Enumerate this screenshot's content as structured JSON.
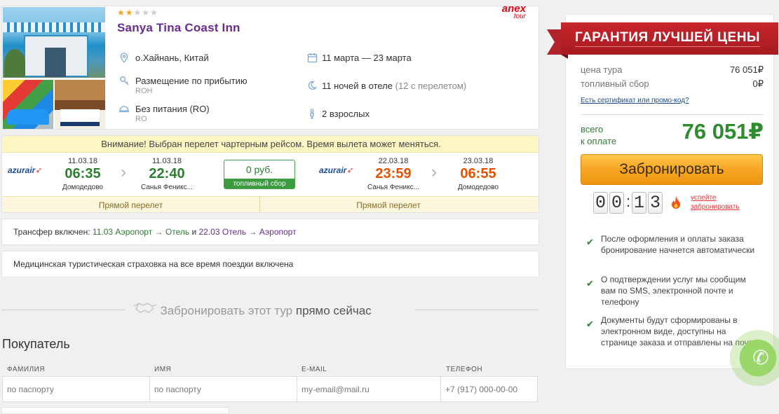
{
  "hotel": {
    "stars_on": "★★",
    "stars_off": "★★★",
    "name": "Sanya Tina Coast Inn",
    "operator_line1": "anex",
    "operator_line2": "tour",
    "location": "о.Хайнань, Китай",
    "room": "Размещение по прибытию",
    "room_code": "ROH",
    "meal": "Без питания (RO)",
    "meal_code": "RO",
    "dates": "11 марта — 23 марта",
    "nights": "11 ночей в отеле",
    "nights_extra": "(12 с перелетом)",
    "guests": "2 взрослых"
  },
  "flight": {
    "warning": "Внимание! Выбран перелет чартерным рейсом. Время вылета может меняться.",
    "airline": "azurair",
    "outbound": {
      "dep_date": "11.03.18",
      "dep_time": "06:35",
      "dep_airport": "Домодедово",
      "arr_date": "11.03.18",
      "arr_time": "22:40",
      "arr_airport": "Санья Феникс..."
    },
    "return": {
      "dep_date": "22.03.18",
      "dep_time": "23:59",
      "dep_airport": "Санья Феникс...",
      "arr_date": "23.03.18",
      "arr_time": "06:55",
      "arr_airport": "Домодедово"
    },
    "fuel_price": "0 руб.",
    "fuel_label": "топливный сбор",
    "direct_out": "Прямой перелет",
    "direct_back": "Прямой перелет"
  },
  "transfer": {
    "prefix": "Трансфер включен:",
    "part1": "11.03 Аэропорт → Отель",
    "and": "и",
    "part2": "22.03 Отель → Аэропорт"
  },
  "insurance": "Медицинская туристическая страховка на все время поездки включена",
  "booking_divider": {
    "text": "Забронировать этот тур",
    "strong": "прямо сейчас"
  },
  "buyer": {
    "title": "Покупатель",
    "columns": [
      {
        "label": "ФАМИЛИЯ",
        "placeholder": "по паспорту"
      },
      {
        "label": "ИМЯ",
        "placeholder": "по паспорту"
      },
      {
        "label": "E-MAIL",
        "placeholder": "my-email@mail.ru"
      },
      {
        "label": "ТЕЛЕФОН",
        "placeholder": "+7 (917) 000-00-00"
      }
    ]
  },
  "sidebar": {
    "ribbon": "ГАРАНТИЯ ЛУЧШЕЙ ЦЕНЫ",
    "tour_price_label": "цена тура",
    "tour_price": "76 051₽",
    "fuel_label": "топливный сбор",
    "fuel_price": "0₽",
    "promo_link": "Есть сертификат или промо-код?",
    "total_label_1": "всего",
    "total_label_2": "к оплате",
    "total": "76 051₽",
    "book_button": "Забронировать",
    "timer": [
      "0",
      "0",
      "1",
      "3"
    ],
    "hurry_1": "успейте",
    "hurry_2": "забронировать",
    "notes": [
      "После оформления и оплаты заказа бронирование начнется автоматически",
      "О подтверждении услуг мы сообщим вам по SMS, электронной почте и телефону",
      "Документы будут сформированы в электронном виде, доступны на странице заказа и отправлены на почту"
    ]
  },
  "colors": {
    "accent_purple": "#6c2b8f",
    "green": "#2e7d32",
    "orange": "#e65100",
    "ribbon_red": "#c6252b",
    "button_orange": "#f6a623"
  }
}
